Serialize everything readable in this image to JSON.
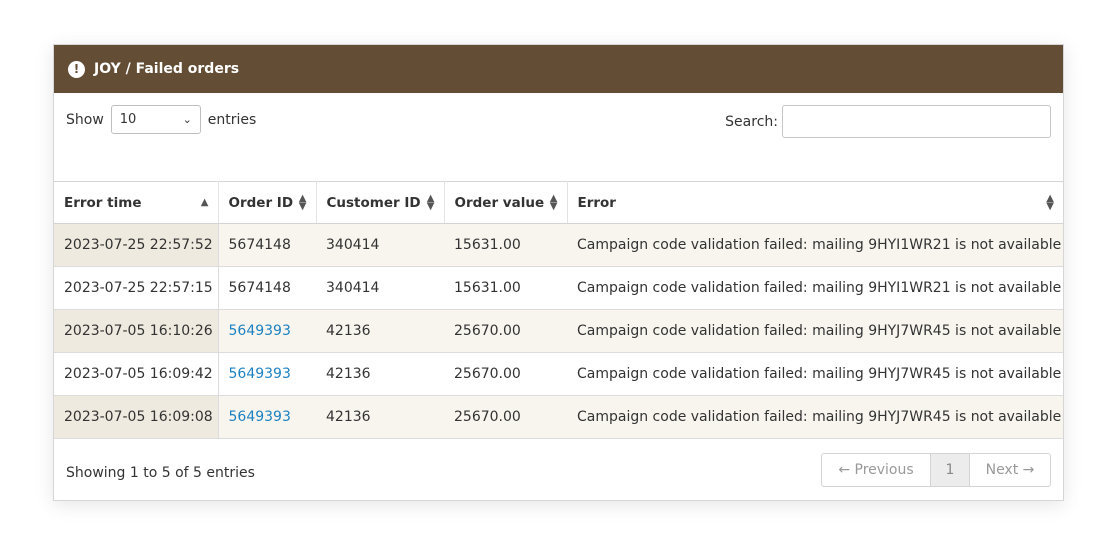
{
  "panel": {
    "title": "JOY / Failed orders",
    "title_icon": "exclamation-circle-icon",
    "header_color": "#634e35"
  },
  "controls": {
    "show_label": "Show",
    "page_size": "10",
    "entries_label": "entries",
    "search_label": "Search:",
    "search_value": ""
  },
  "table": {
    "columns": [
      "Error time",
      "Order ID",
      "Customer ID",
      "Order value",
      "Error"
    ],
    "rows": [
      {
        "time": "2023-07-25 22:57:52",
        "order_id": "5674148",
        "customer_id": "340414",
        "value": "15631.00",
        "error": "Campaign code validation failed: mailing 9HYI1WR21 is not available"
      },
      {
        "time": "2023-07-25 22:57:15",
        "order_id": "5674148",
        "customer_id": "340414",
        "value": "15631.00",
        "error": "Campaign code validation failed: mailing 9HYI1WR21 is not available"
      },
      {
        "time": "2023-07-05 16:10:26",
        "order_id": "5649393",
        "customer_id": "42136",
        "value": "25670.00",
        "error": "Campaign code validation failed: mailing 9HYJ7WR45 is not available"
      },
      {
        "time": "2023-07-05 16:09:42",
        "order_id": "5649393",
        "customer_id": "42136",
        "value": "25670.00",
        "error": "Campaign code validation failed: mailing 9HYJ7WR45 is not available"
      },
      {
        "time": "2023-07-05 16:09:08",
        "order_id": "5649393",
        "customer_id": "42136",
        "value": "25670.00",
        "error": "Campaign code validation failed: mailing 9HYJ7WR45 is not available"
      }
    ]
  },
  "footer": {
    "info": "Showing 1 to 5 of 5 entries",
    "prev_label": "← Previous",
    "page": "1",
    "next_label": "Next →"
  }
}
